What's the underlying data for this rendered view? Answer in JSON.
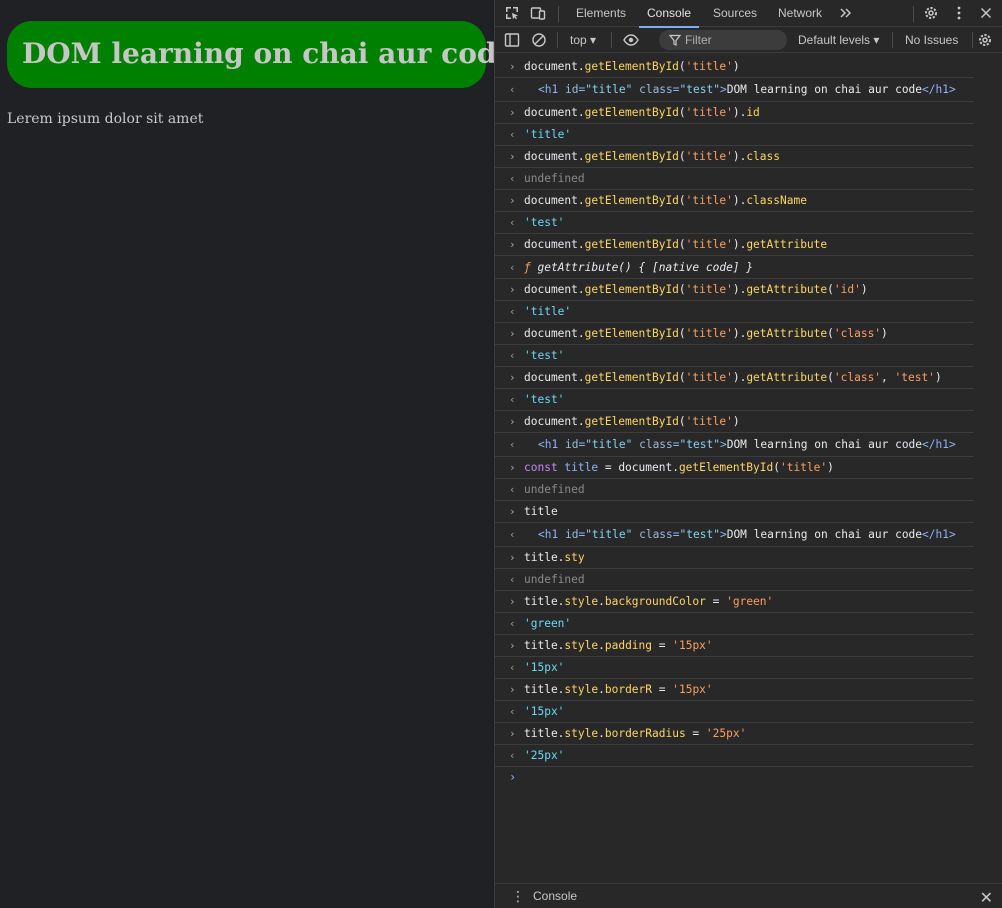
{
  "page": {
    "heading": "DOM learning on chai aur code",
    "paragraph": "Lerem ipsum dolor sit amet"
  },
  "devtools": {
    "tabs": [
      "Elements",
      "Console",
      "Sources",
      "Network"
    ],
    "active_tab": "Console",
    "more_tabs_icon": "chevron-double-right-icon",
    "toolbar": {
      "context": "top",
      "filter_placeholder": "Filter",
      "levels": "Default levels",
      "issues": "No Issues"
    },
    "drawer_title": "Console",
    "accent": "#7cacf8"
  },
  "console": [
    {
      "kind": "in",
      "tokens": [
        [
          "p",
          "document."
        ],
        [
          "f",
          "getElementById"
        ],
        [
          "p",
          "("
        ],
        [
          "s",
          "'title'"
        ],
        [
          "p",
          ")"
        ]
      ]
    },
    {
      "kind": "out-html",
      "tokens": [
        [
          "t",
          "<h1 "
        ],
        [
          "a",
          "id"
        ],
        [
          "t",
          "="
        ],
        [
          "v",
          "\"title\""
        ],
        [
          "t",
          " "
        ],
        [
          "a",
          "class"
        ],
        [
          "t",
          "="
        ],
        [
          "v",
          "\"test\""
        ],
        [
          "t",
          ">"
        ],
        [
          "x",
          "DOM learning on chai aur code"
        ],
        [
          "t",
          "</h1>"
        ]
      ]
    },
    {
      "kind": "in",
      "tokens": [
        [
          "p",
          "document."
        ],
        [
          "f",
          "getElementById"
        ],
        [
          "p",
          "("
        ],
        [
          "s",
          "'title'"
        ],
        [
          "p",
          ")."
        ],
        [
          "f",
          "id"
        ]
      ]
    },
    {
      "kind": "out",
      "tokens": [
        [
          "r",
          "'title'"
        ]
      ]
    },
    {
      "kind": "in",
      "tokens": [
        [
          "p",
          "document."
        ],
        [
          "f",
          "getElementById"
        ],
        [
          "p",
          "("
        ],
        [
          "s",
          "'title'"
        ],
        [
          "p",
          ")."
        ],
        [
          "f",
          "class"
        ]
      ]
    },
    {
      "kind": "out",
      "tokens": [
        [
          "u",
          "undefined"
        ]
      ]
    },
    {
      "kind": "in",
      "tokens": [
        [
          "p",
          "document."
        ],
        [
          "f",
          "getElementById"
        ],
        [
          "p",
          "("
        ],
        [
          "s",
          "'title'"
        ],
        [
          "p",
          ")."
        ],
        [
          "f",
          "className"
        ]
      ]
    },
    {
      "kind": "out",
      "tokens": [
        [
          "r",
          "'test'"
        ]
      ]
    },
    {
      "kind": "in",
      "tokens": [
        [
          "p",
          "document."
        ],
        [
          "f",
          "getElementById"
        ],
        [
          "p",
          "("
        ],
        [
          "s",
          "'title'"
        ],
        [
          "p",
          ")."
        ],
        [
          "f",
          "getAttribute"
        ]
      ]
    },
    {
      "kind": "out-func",
      "tokens": [
        [
          "ff",
          "ƒ "
        ],
        [
          "fn",
          "getAttribute() { [native code] }"
        ]
      ]
    },
    {
      "kind": "in",
      "tokens": [
        [
          "p",
          "document."
        ],
        [
          "f",
          "getElementById"
        ],
        [
          "p",
          "("
        ],
        [
          "s",
          "'title'"
        ],
        [
          "p",
          ")."
        ],
        [
          "f",
          "getAttribute"
        ],
        [
          "p",
          "("
        ],
        [
          "s",
          "'id'"
        ],
        [
          "p",
          ")"
        ]
      ]
    },
    {
      "kind": "out",
      "tokens": [
        [
          "r",
          "'title'"
        ]
      ]
    },
    {
      "kind": "in",
      "tokens": [
        [
          "p",
          "document."
        ],
        [
          "f",
          "getElementById"
        ],
        [
          "p",
          "("
        ],
        [
          "s",
          "'title'"
        ],
        [
          "p",
          ")."
        ],
        [
          "f",
          "getAttribute"
        ],
        [
          "p",
          "("
        ],
        [
          "s",
          "'class'"
        ],
        [
          "p",
          ")"
        ]
      ]
    },
    {
      "kind": "out",
      "tokens": [
        [
          "r",
          "'test'"
        ]
      ]
    },
    {
      "kind": "in",
      "tokens": [
        [
          "p",
          "document."
        ],
        [
          "f",
          "getElementById"
        ],
        [
          "p",
          "("
        ],
        [
          "s",
          "'title'"
        ],
        [
          "p",
          ")."
        ],
        [
          "f",
          "getAttribute"
        ],
        [
          "p",
          "("
        ],
        [
          "s",
          "'class'"
        ],
        [
          "p",
          ", "
        ],
        [
          "s",
          "'test'"
        ],
        [
          "p",
          ")"
        ]
      ]
    },
    {
      "kind": "out",
      "tokens": [
        [
          "r",
          "'test'"
        ]
      ]
    },
    {
      "kind": "in",
      "tokens": [
        [
          "p",
          "document."
        ],
        [
          "f",
          "getElementById"
        ],
        [
          "p",
          "("
        ],
        [
          "s",
          "'title'"
        ],
        [
          "p",
          ")"
        ]
      ]
    },
    {
      "kind": "out-html",
      "tokens": [
        [
          "t",
          "<h1 "
        ],
        [
          "a",
          "id"
        ],
        [
          "t",
          "="
        ],
        [
          "v",
          "\"title\""
        ],
        [
          "t",
          " "
        ],
        [
          "a",
          "class"
        ],
        [
          "t",
          "="
        ],
        [
          "v",
          "\"test\""
        ],
        [
          "t",
          ">"
        ],
        [
          "x",
          "DOM learning on chai aur code"
        ],
        [
          "t",
          "</h1>"
        ]
      ]
    },
    {
      "kind": "in",
      "tokens": [
        [
          "k",
          "const "
        ],
        [
          "vr",
          "title"
        ],
        [
          "p",
          " = document."
        ],
        [
          "f",
          "getElementById"
        ],
        [
          "p",
          "("
        ],
        [
          "s",
          "'title'"
        ],
        [
          "p",
          ")"
        ]
      ]
    },
    {
      "kind": "out",
      "tokens": [
        [
          "u",
          "undefined"
        ]
      ]
    },
    {
      "kind": "in",
      "tokens": [
        [
          "p",
          "title"
        ]
      ]
    },
    {
      "kind": "out-html",
      "tokens": [
        [
          "t",
          "<h1 "
        ],
        [
          "a",
          "id"
        ],
        [
          "t",
          "="
        ],
        [
          "v",
          "\"title\""
        ],
        [
          "t",
          " "
        ],
        [
          "a",
          "class"
        ],
        [
          "t",
          "="
        ],
        [
          "v",
          "\"test\""
        ],
        [
          "t",
          ">"
        ],
        [
          "x",
          "DOM learning on chai aur code"
        ],
        [
          "t",
          "</h1>"
        ]
      ]
    },
    {
      "kind": "in",
      "tokens": [
        [
          "p",
          "title."
        ],
        [
          "f",
          "sty"
        ]
      ]
    },
    {
      "kind": "out",
      "tokens": [
        [
          "u",
          "undefined"
        ]
      ]
    },
    {
      "kind": "in",
      "tokens": [
        [
          "p",
          "title."
        ],
        [
          "f",
          "style"
        ],
        [
          "p",
          "."
        ],
        [
          "f",
          "backgroundColor"
        ],
        [
          "p",
          " = "
        ],
        [
          "s",
          "'green'"
        ]
      ]
    },
    {
      "kind": "out",
      "tokens": [
        [
          "r",
          "'green'"
        ]
      ]
    },
    {
      "kind": "in",
      "tokens": [
        [
          "p",
          "title."
        ],
        [
          "f",
          "style"
        ],
        [
          "p",
          "."
        ],
        [
          "f",
          "padding"
        ],
        [
          "p",
          " = "
        ],
        [
          "s",
          "'15px'"
        ]
      ]
    },
    {
      "kind": "out",
      "tokens": [
        [
          "r",
          "'15px'"
        ]
      ]
    },
    {
      "kind": "in",
      "tokens": [
        [
          "p",
          "title."
        ],
        [
          "f",
          "style"
        ],
        [
          "p",
          "."
        ],
        [
          "f",
          "borderR"
        ],
        [
          "p",
          " = "
        ],
        [
          "s",
          "'15px'"
        ]
      ]
    },
    {
      "kind": "out",
      "tokens": [
        [
          "r",
          "'15px'"
        ]
      ]
    },
    {
      "kind": "in",
      "tokens": [
        [
          "p",
          "title."
        ],
        [
          "f",
          "style"
        ],
        [
          "p",
          "."
        ],
        [
          "f",
          "borderRadius"
        ],
        [
          "p",
          " = "
        ],
        [
          "s",
          "'25px'"
        ]
      ]
    },
    {
      "kind": "out",
      "tokens": [
        [
          "r",
          "'25px'"
        ]
      ]
    }
  ]
}
